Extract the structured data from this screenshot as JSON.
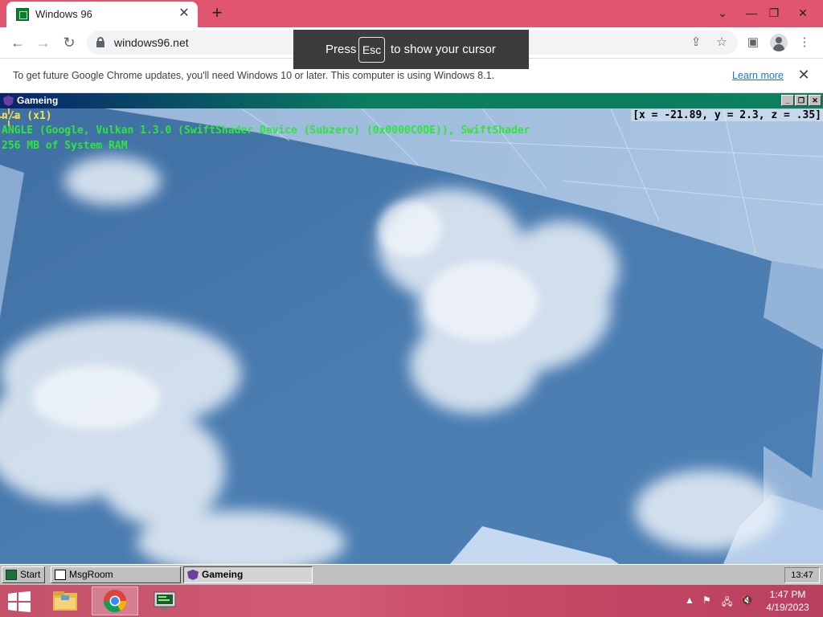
{
  "browser": {
    "tab": {
      "title": "Windows 96"
    },
    "url": "windows96.net",
    "toast": {
      "pre": "Press",
      "key": "Esc",
      "post": "to show your cursor"
    },
    "infobar": {
      "message": "To get future Google Chrome updates, you'll need Windows 10 or later. This computer is using Windows 8.1.",
      "link": "Learn more"
    }
  },
  "game_window": {
    "title": "Gameing",
    "hud": {
      "line1": "n/a (x1)",
      "line2": "ANGLE (Google, Vulkan 1.3.0 (SwiftShader Device (Subzero) (0x0000C0DE)), SwiftShader",
      "line3": "256 MB of System RAM",
      "coords": "[x = -21.89, y = 2.3, z = .35]"
    }
  },
  "win96_taskbar": {
    "start_label": "Start",
    "buttons": [
      {
        "label": "MsgRoom",
        "active": false
      },
      {
        "label": "Gameing",
        "active": true
      }
    ],
    "clock": "13:47"
  },
  "host_taskbar": {
    "apps": [
      "file-explorer",
      "chrome",
      "system-app"
    ],
    "time": "1:47 PM",
    "date": "4/19/2023"
  },
  "colors": {
    "chrome_frame": "#e0566f",
    "hud_yellow": "#f0e84a",
    "hud_green": "#2ee63a",
    "sky": "#4a79ab",
    "win96_gray": "#c0c0c0"
  }
}
